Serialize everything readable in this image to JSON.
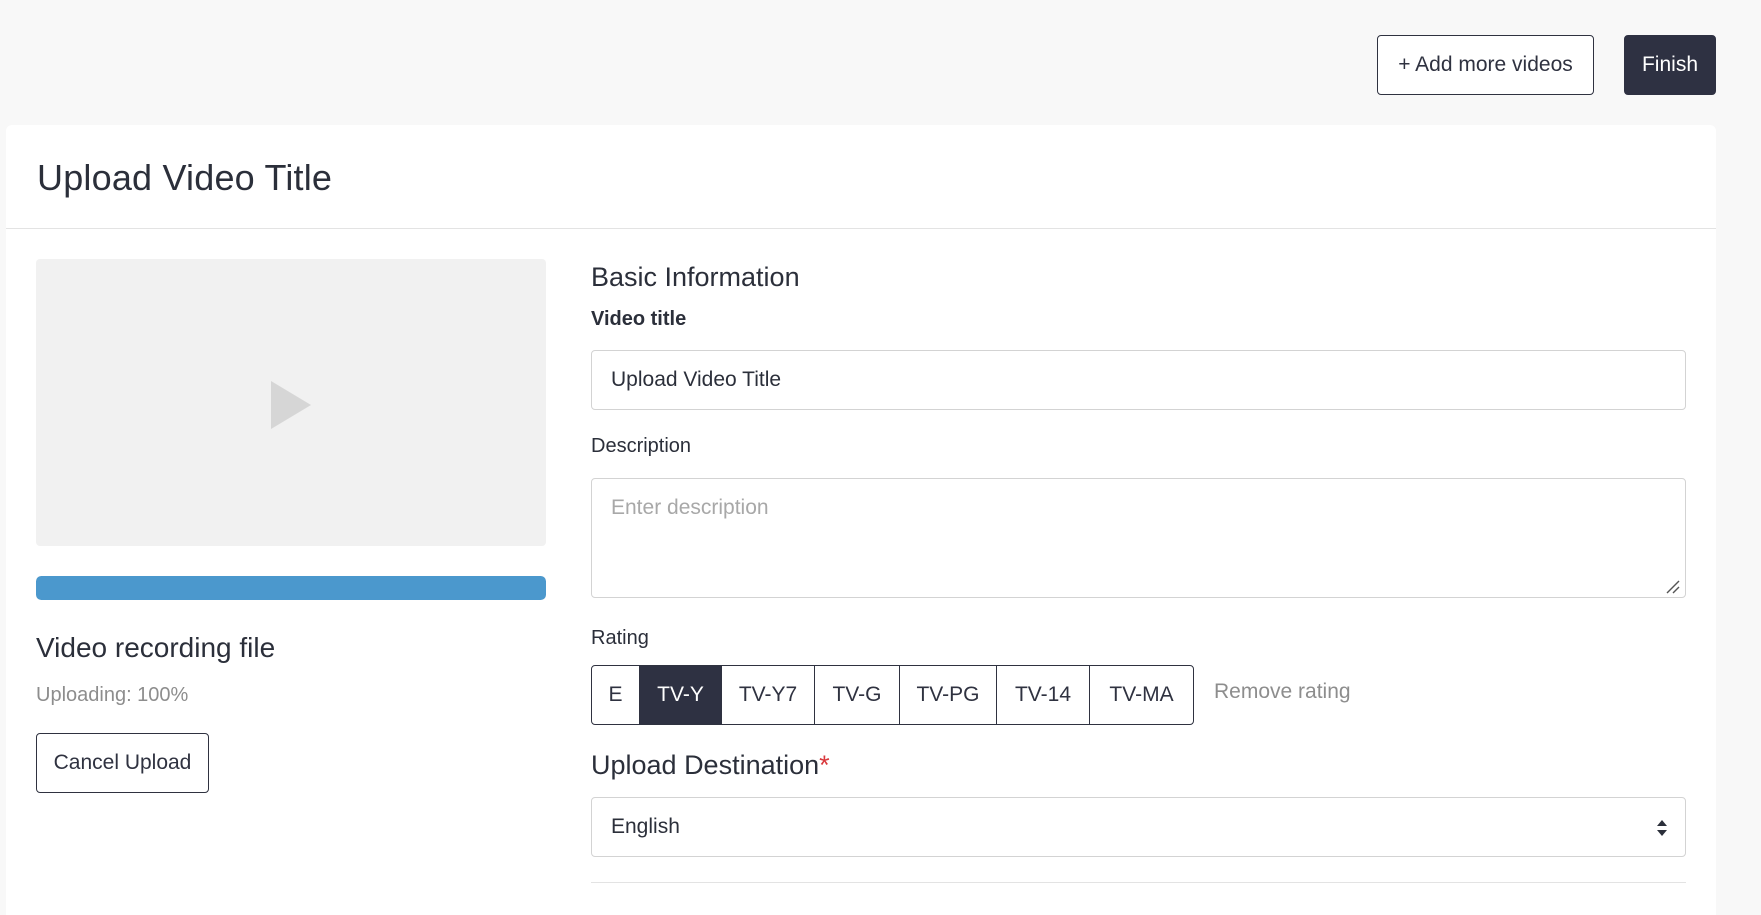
{
  "toolbar": {
    "add_more_label": "+ Add more videos",
    "finish_label": "Finish"
  },
  "page": {
    "title": "Upload Video Title"
  },
  "video": {
    "file_label": "Video recording file",
    "upload_status": "Uploading: 100%",
    "progress": 1.0,
    "cancel_label": "Cancel Upload"
  },
  "basic_info": {
    "section_title": "Basic Information",
    "title_label": "Video title",
    "title_value": "Upload Video Title",
    "description_label": "Description",
    "description_placeholder": "Enter description",
    "description_value": ""
  },
  "rating": {
    "label": "Rating",
    "options": [
      "E",
      "TV-Y",
      "TV-Y7",
      "TV-G",
      "TV-PG",
      "TV-14",
      "TV-MA"
    ],
    "selected": "TV-Y",
    "remove_label": "Remove rating"
  },
  "destination": {
    "label": "Upload Destination",
    "required_marker": "*",
    "selected": "English"
  },
  "colors": {
    "accent_dark": "#2e3142",
    "progress": "#4b98cd",
    "required": "#d9383c"
  }
}
